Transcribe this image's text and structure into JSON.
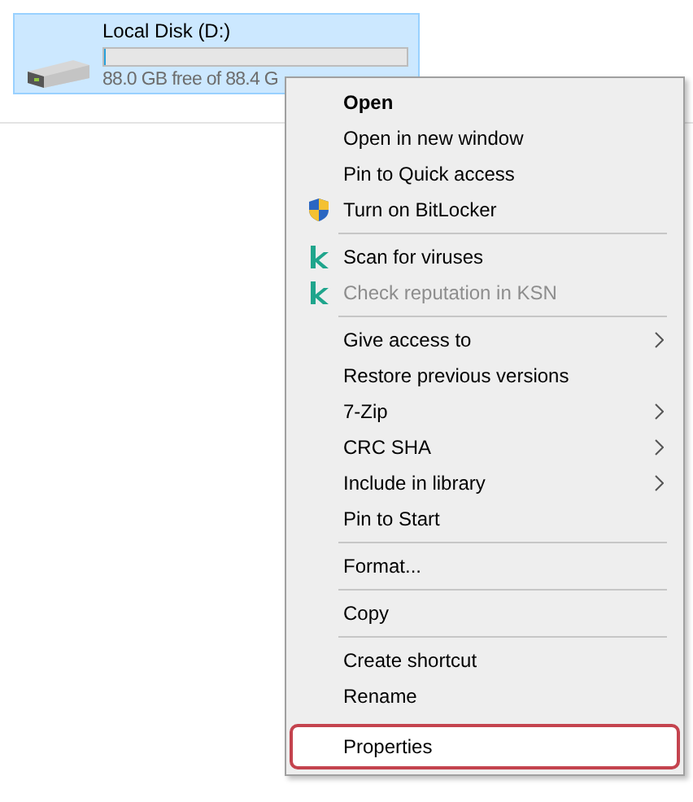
{
  "drive": {
    "name": "Local Disk (D:)",
    "level": 0.005,
    "free_text": "88.0 GB free of 88.4 G",
    "selected": true
  },
  "context_menu": {
    "items": [
      {
        "kind": "item",
        "label": "Open",
        "default": true,
        "disabled": false,
        "submenu": false,
        "selected": false
      },
      {
        "kind": "item",
        "label": "Open in new window",
        "default": false,
        "disabled": false,
        "submenu": false,
        "selected": false
      },
      {
        "kind": "item",
        "label": "Pin to Quick access",
        "default": false,
        "disabled": false,
        "submenu": false,
        "selected": false
      },
      {
        "kind": "shield",
        "label": "Turn on BitLocker",
        "default": false,
        "disabled": false,
        "submenu": false,
        "selected": false
      },
      {
        "kind": "separator"
      },
      {
        "kind": "antivirus",
        "label": "Scan for viruses",
        "default": false,
        "disabled": false,
        "submenu": false,
        "selected": false
      },
      {
        "kind": "antivirus",
        "label": "Check reputation in KSN",
        "default": false,
        "disabled": true,
        "submenu": false,
        "selected": false
      },
      {
        "kind": "separator"
      },
      {
        "kind": "item",
        "label": "Give access to",
        "default": false,
        "disabled": false,
        "submenu": true,
        "selected": false
      },
      {
        "kind": "item",
        "label": "Restore previous versions",
        "default": false,
        "disabled": false,
        "submenu": false,
        "selected": false
      },
      {
        "kind": "item",
        "label": "7-Zip",
        "default": false,
        "disabled": false,
        "submenu": true,
        "selected": false
      },
      {
        "kind": "item",
        "label": "CRC SHA",
        "default": false,
        "disabled": false,
        "submenu": true,
        "selected": false
      },
      {
        "kind": "item",
        "label": "Include in library",
        "default": false,
        "disabled": false,
        "submenu": true,
        "selected": false
      },
      {
        "kind": "item",
        "label": "Pin to Start",
        "default": false,
        "disabled": false,
        "submenu": false,
        "selected": false
      },
      {
        "kind": "separator"
      },
      {
        "kind": "item",
        "label": "Format...",
        "default": false,
        "disabled": false,
        "submenu": false,
        "selected": false
      },
      {
        "kind": "separator"
      },
      {
        "kind": "item",
        "label": "Copy",
        "default": false,
        "disabled": false,
        "submenu": false,
        "selected": false
      },
      {
        "kind": "separator"
      },
      {
        "kind": "item",
        "label": "Create shortcut",
        "default": false,
        "disabled": false,
        "submenu": false,
        "selected": false
      },
      {
        "kind": "item",
        "label": "Rename",
        "default": false,
        "disabled": false,
        "submenu": false,
        "selected": false
      },
      {
        "kind": "item",
        "label": "Properties",
        "default": false,
        "disabled": false,
        "submenu": false,
        "selected": true
      }
    ]
  }
}
